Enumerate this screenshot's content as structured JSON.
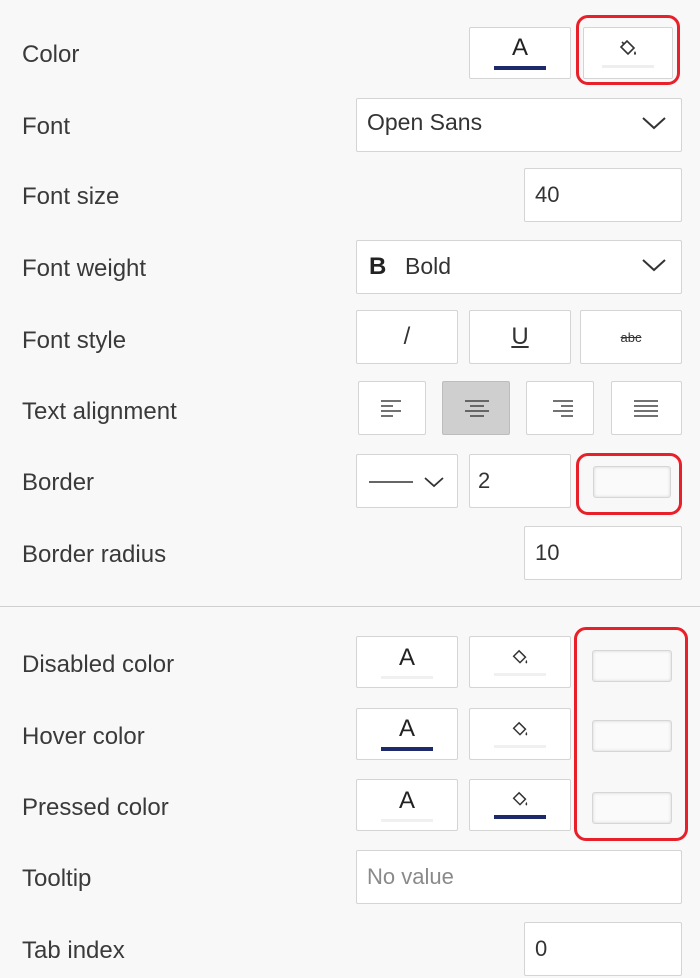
{
  "rows": {
    "color": {
      "label": "Color"
    },
    "font": {
      "label": "Font",
      "value": "Open Sans"
    },
    "font_size": {
      "label": "Font size",
      "value": "40"
    },
    "font_weight": {
      "label": "Font weight",
      "value": "Bold",
      "icon_letter": "B"
    },
    "font_style": {
      "label": "Font style",
      "italic": "/",
      "underline": "U",
      "strike": "abc"
    },
    "text_alignment": {
      "label": "Text alignment",
      "selected": "center"
    },
    "border": {
      "label": "Border",
      "width": "2"
    },
    "border_radius": {
      "label": "Border radius",
      "value": "10"
    },
    "disabled_color": {
      "label": "Disabled color"
    },
    "hover_color": {
      "label": "Hover color"
    },
    "pressed_color": {
      "label": "Pressed color"
    },
    "tooltip": {
      "label": "Tooltip",
      "placeholder": "No value"
    },
    "tab_index": {
      "label": "Tab index",
      "value": "0"
    }
  },
  "glyphs": {
    "font_color": "A"
  },
  "colors": {
    "accent_navy": "#1c2a6b",
    "highlight_red": "#e8202a",
    "selected_gray": "#cfcfcf"
  }
}
